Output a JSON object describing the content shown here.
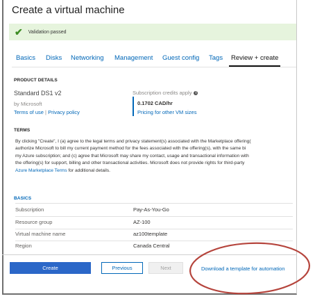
{
  "window": {
    "title": "Create a virtual machine"
  },
  "banner": {
    "icon": "checkmark-icon",
    "text": "Validation passed",
    "color": "#3c8c23"
  },
  "tabs": [
    {
      "label": "Basics"
    },
    {
      "label": "Disks"
    },
    {
      "label": "Networking"
    },
    {
      "label": "Management"
    },
    {
      "label": "Guest config"
    },
    {
      "label": "Tags"
    },
    {
      "label": "Review + create",
      "active": true
    }
  ],
  "product": {
    "heading": "PRODUCT DETAILS",
    "name": "Standard DS1 v2",
    "publisher": "by Microsoft",
    "terms_link": "Terms of use",
    "separator": "|",
    "privacy_link": "Privacy policy",
    "credits_label": "Subscription credits apply",
    "credits_icon": "info-icon",
    "price": "0.1702 CAD/hr",
    "pricing_link": "Pricing for other VM sizes"
  },
  "terms": {
    "heading": "TERMS",
    "lines": [
      "By clicking \"Create\", I (a) agree to the legal terms and privacy statement(s) associated with the Marketplace offering(",
      "authorize Microsoft to bill my current payment method for the fees associated with the offering(s), with the same bi",
      "my Azure subscription; and (c) agree that Microsoft may share my contact, usage and transactional information with",
      "the offering(s) for support, billing and other transactional activities. Microsoft does not provide rights for third-party"
    ],
    "marketplace_link": "Azure Marketplace Terms",
    "suffix": " for additional details."
  },
  "basics": {
    "heading": "BASICS",
    "rows": [
      {
        "key": "Subscription",
        "value": "Pay-As-You-Go"
      },
      {
        "key": "Resource group",
        "value": "AZ-100"
      },
      {
        "key": "Virtual machine name",
        "value": "az100template"
      },
      {
        "key": "Region",
        "value": "Canada Central"
      }
    ]
  },
  "footer": {
    "create_label": "Create",
    "previous_label": "Previous",
    "next_label": "Next",
    "download_link": "Download a template for automation"
  },
  "colors": {
    "accent": "#0067b8",
    "primary_button": "#2b67c8",
    "annotation": "#b5443c"
  }
}
